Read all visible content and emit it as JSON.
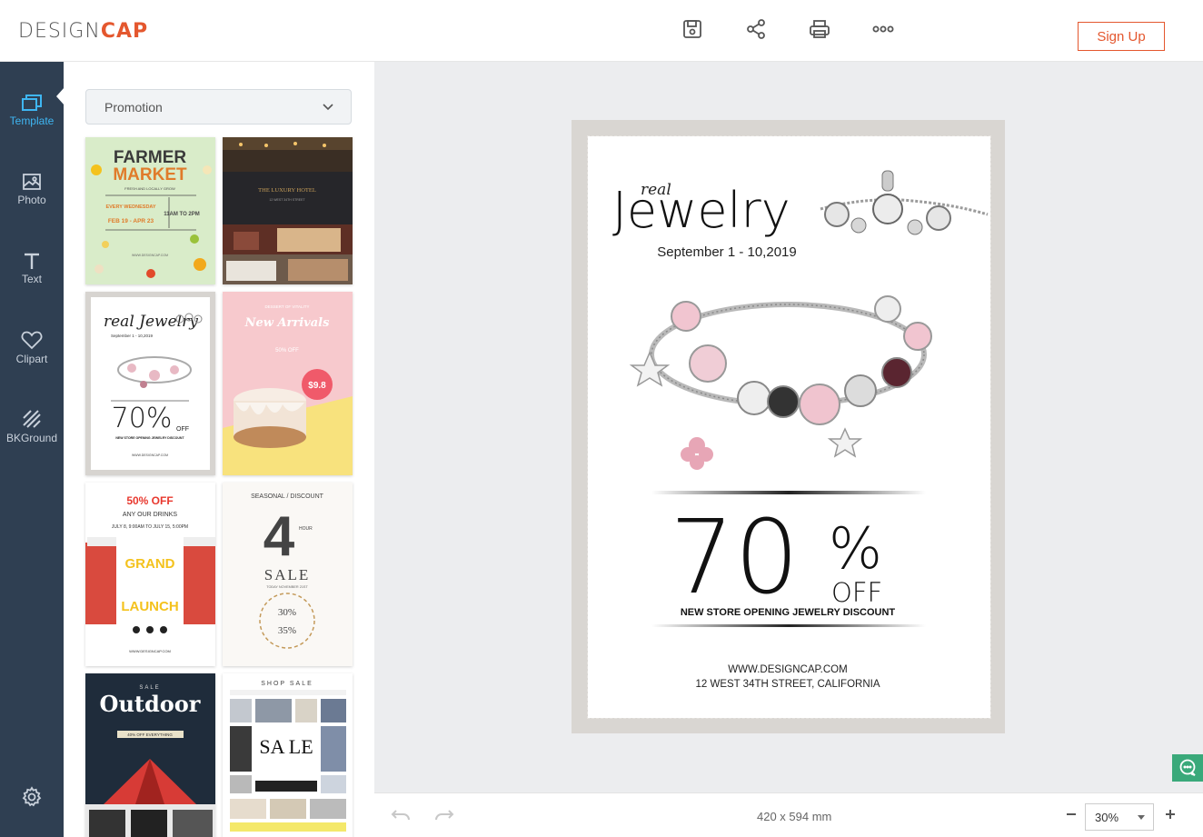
{
  "brand": {
    "logo_left": "DESIGN",
    "logo_right": "CAP"
  },
  "toolbar": {
    "save": "save-icon",
    "share": "share-icon",
    "print": "print-icon",
    "more": "more-icon",
    "signup_label": "Sign Up"
  },
  "rail": {
    "items": [
      {
        "label": "Template",
        "icon": "template-icon"
      },
      {
        "label": "Photo",
        "icon": "photo-icon"
      },
      {
        "label": "Text",
        "icon": "text-icon"
      },
      {
        "label": "Clipart",
        "icon": "heart-icon"
      },
      {
        "label": "BKGround",
        "icon": "background-icon"
      }
    ]
  },
  "panel": {
    "category": "Promotion",
    "templates": [
      {
        "title": "FARMER",
        "title2": "MARKET",
        "sub": "FRESH AND LOCALLY GROW",
        "day": "EVERY WEDNESDAY",
        "dates": "FEB 19 - APR 23",
        "time": "11AM TO 2PM",
        "footer": "WWW.DESIGNCAP.COM"
      },
      {
        "title": "THE LUXURY HOTEL",
        "sub": "12 WEST 34TH STREET"
      },
      {
        "title": "real Jewelry",
        "dates": "September 1 - 10,2019",
        "percent": "70%",
        "off": "OFF",
        "tag": "NEW STORE OPENING JEWELRY DISCOUNT",
        "footer": "WWW.DESIGNCAP.COM"
      },
      {
        "kicker": "DESSERT OF VITALITY",
        "title": "New Arrivals",
        "deal": "50% OFF",
        "price": "$9.8"
      },
      {
        "headline": "50% OFF",
        "sub": "ANY OUR DRINKS",
        "dates": "JULY 8, 9:00AM TO JULY 15, 5:00PM",
        "title": "GRAND",
        "title2": "LAUNCH",
        "footer": "WWW.DESIGNCAP.COM"
      },
      {
        "kicker": "SEASONAL / DISCOUNT",
        "big": "4",
        "vert": "HOUR",
        "title": "SALE",
        "sub": "TODAY NOVEMBER 21ST",
        "p1": "30%",
        "p2": "35%"
      },
      {
        "kicker": "SALE",
        "title": "Outdoor",
        "sub": "40% OFF EVERYTHING"
      },
      {
        "kicker": "SHOP SALE",
        "title": "SA LE"
      }
    ]
  },
  "poster": {
    "script": "real",
    "title": "Jewelry",
    "dates": "September 1 - 10,2019",
    "number": "70",
    "percent": "%",
    "off": "OFF",
    "tagline": "NEW STORE OPENING JEWELRY DISCOUNT",
    "website": "WWW.DESIGNCAP.COM",
    "address": "12 WEST 34TH STREET, CALIFORNIA"
  },
  "status": {
    "size": "420 x 594 mm",
    "zoom": "30%"
  },
  "colors": {
    "accent": "#e4572e",
    "rail": "#2f3f52",
    "active": "#3fb6f2",
    "chat": "#3aa97a"
  }
}
